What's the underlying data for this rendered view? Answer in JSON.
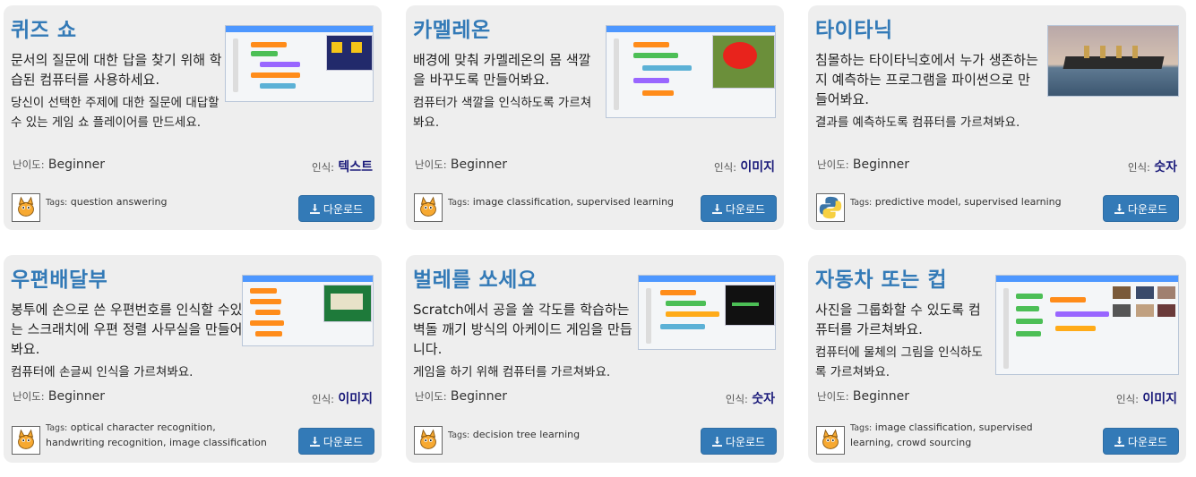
{
  "cards": [
    {
      "title": "퀴즈 쇼",
      "desc1": "문서의 질문에 대한 답을 찾기 위해 학습된 컴퓨터를 사용하세요.",
      "desc2": "당신이 선택한 주제에 대한 질문에 대답할 수 있는 게임 쇼 플레이어를 만드세요.",
      "level_label": "난이도:",
      "level": "Beginner",
      "recognition_label": "인식:",
      "recognition": "텍스트",
      "tags_label": "Tags:",
      "tags": "question answering",
      "download": "다운로드",
      "icon": "scratch-cat-icon"
    },
    {
      "title": "카멜레온",
      "desc1": "배경에 맞춰 카멜레온의 몸 색깔을 바꾸도록 만들어봐요.",
      "desc2": "컴퓨터가 색깔을 인식하도록 가르쳐봐요.",
      "level_label": "난이도:",
      "level": "Beginner",
      "recognition_label": "인식:",
      "recognition": "이미지",
      "tags_label": "Tags:",
      "tags": "image classification, supervised learning",
      "download": "다운로드",
      "icon": "scratch-cat-icon"
    },
    {
      "title": "타이타닉",
      "desc1": "침몰하는 타이타닉호에서 누가 생존하는지 예측하는 프로그램을 파이썬으로 만들어봐요.",
      "desc2": "결과를 예측하도록 컴퓨터를 가르쳐봐요.",
      "level_label": "난이도:",
      "level": "Beginner",
      "recognition_label": "인식:",
      "recognition": "숫자",
      "tags_label": "Tags:",
      "tags": "predictive model, supervised learning",
      "download": "다운로드",
      "icon": "python-logo-icon"
    },
    {
      "title": "우편배달부",
      "desc1": "봉투에 손으로 쓴 우편번호를 인식할 수있는 스크래치에 우편 정렬 사무실을 만들어봐요.",
      "desc2": "컴퓨터에 손글씨 인식을 가르쳐봐요.",
      "level_label": "난이도:",
      "level": "Beginner",
      "recognition_label": "인식:",
      "recognition": "이미지",
      "tags_label": "Tags:",
      "tags": "optical character recognition, handwriting recognition, image classification",
      "download": "다운로드",
      "icon": "scratch-cat-icon"
    },
    {
      "title": "벌레를 쏘세요",
      "desc1": "Scratch에서 공을 쏠 각도를 학습하는 벽돌 깨기 방식의 아케이드 게임을 만듭니다.",
      "desc2": "게임을 하기 위해 컴퓨터를 가르쳐봐요.",
      "level_label": "난이도:",
      "level": "Beginner",
      "recognition_label": "인식:",
      "recognition": "숫자",
      "tags_label": "Tags:",
      "tags": "decision tree learning",
      "download": "다운로드",
      "icon": "scratch-cat-icon"
    },
    {
      "title": "자동차 또는 컵",
      "desc1": "사진을 그룹화할 수 있도록 컴퓨터를 가르쳐봐요.",
      "desc2": "컴퓨터에 물체의 그림을 인식하도록 가르쳐봐요.",
      "level_label": "난이도:",
      "level": "Beginner",
      "recognition_label": "인식:",
      "recognition": "이미지",
      "tags_label": "Tags:",
      "tags": "image classification, supervised learning, crowd sourcing",
      "download": "다운로드",
      "icon": "scratch-cat-icon"
    }
  ],
  "colors": {
    "title": "#337ab7",
    "button": "#337ab7",
    "card_bg": "#eeeeee",
    "recognition": "#1a1a7a"
  }
}
